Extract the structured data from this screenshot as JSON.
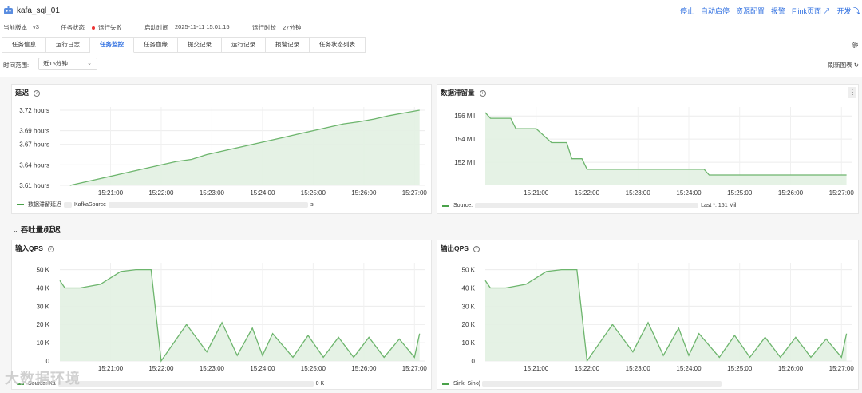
{
  "header": {
    "job_name": "kafa_sql_01",
    "actions": [
      "停止",
      "自动启停",
      "资源配置",
      "报警",
      "Flink页面 ↗",
      "开发 ⤵"
    ]
  },
  "meta": {
    "version_label": "当前版本",
    "version_value": "v3",
    "status_label": "任务状态",
    "status_value": "运行失败",
    "start_label": "启动时间",
    "start_value": "2025-11-11 15:01:15",
    "duration_label": "运行时长",
    "duration_value": "27分钟"
  },
  "tabs": [
    "任务信息",
    "运行日志",
    "任务监控",
    "任务血缘",
    "提交记录",
    "运行记录",
    "报警记录",
    "任务状态列表"
  ],
  "active_tab": 2,
  "time_range": {
    "label": "时间范围:",
    "value": "近15分钟",
    "refresh_label": "刷新图表 ↻"
  },
  "section": {
    "title": "吞吐量/延迟"
  },
  "watermark": "大数据环境",
  "colors": {
    "series": "#6db56d",
    "fill": "#e2f1e2",
    "accent": "#2f6fe0",
    "status": "#e33333"
  },
  "panels": {
    "latency": {
      "title": "延迟",
      "legend": "数据滞留延迟",
      "legend_rest": "KafkaSource",
      "legend_tail": "s"
    },
    "backlog": {
      "title": "数据滞留量",
      "legend": "Source:",
      "legend_tail": "Last *: 151 Mil"
    },
    "input_qps": {
      "title": "输入QPS",
      "legend": "Source: Ka",
      "legend_tail": "0 K"
    },
    "output_qps": {
      "title": "输出QPS",
      "legend": "Sink: Sink(",
      "legend_tail": ""
    }
  },
  "chart_data": [
    {
      "type": "area",
      "title": "延迟",
      "yunit": "hours",
      "yticks": [
        "3.61 hours",
        "3.64 hours",
        "3.67 hours",
        "3.69 hours",
        "3.72 hours"
      ],
      "ylim": [
        3.61,
        3.72
      ],
      "xticks": [
        "15:21:00",
        "15:22:00",
        "15:23:00",
        "15:24:00",
        "15:25:00",
        "15:26:00",
        "15:27:00"
      ],
      "x": [
        20.2,
        20.5,
        20.8,
        21.1,
        21.4,
        21.7,
        22.0,
        22.3,
        22.6,
        22.9,
        23.2,
        23.5,
        23.8,
        24.1,
        24.4,
        24.7,
        25.0,
        25.3,
        25.6,
        25.9,
        26.2,
        26.5,
        26.8,
        27.1
      ],
      "values": [
        3.61,
        3.615,
        3.62,
        3.625,
        3.63,
        3.635,
        3.64,
        3.645,
        3.648,
        3.655,
        3.66,
        3.665,
        3.67,
        3.675,
        3.68,
        3.685,
        3.69,
        3.695,
        3.7,
        3.703,
        3.707,
        3.712,
        3.716,
        3.72
      ],
      "series": [
        {
          "name": "数据滞留延迟"
        }
      ]
    },
    {
      "type": "area",
      "title": "数据滞留量",
      "yticks": [
        "152 Mil",
        "154 Mil",
        "156 Mil"
      ],
      "ylim": [
        150,
        156.5
      ],
      "xticks": [
        "15:21:00",
        "15:22:00",
        "15:23:00",
        "15:24:00",
        "15:25:00",
        "15:26:00",
        "15:27:00"
      ],
      "x": [
        20.0,
        20.1,
        20.3,
        20.5,
        20.6,
        20.9,
        21.0,
        21.3,
        21.4,
        21.6,
        21.7,
        21.9,
        22.0,
        22.5,
        23.0,
        23.5,
        24.0,
        24.3,
        24.4,
        25.0,
        25.5,
        26.0,
        26.5,
        27.1
      ],
      "values": [
        156.3,
        155.8,
        155.8,
        155.8,
        154.9,
        154.9,
        154.9,
        153.7,
        153.7,
        153.7,
        152.3,
        152.3,
        151.4,
        151.4,
        151.4,
        151.4,
        151.4,
        151.4,
        150.9,
        150.9,
        150.9,
        150.9,
        150.9,
        150.9
      ],
      "series": [
        {
          "name": "Source:"
        }
      ]
    },
    {
      "type": "area",
      "title": "输入QPS",
      "yticks": [
        "0",
        "10 K",
        "20 K",
        "30 K",
        "40 K",
        "50 K"
      ],
      "ylim": [
        0,
        52
      ],
      "xticks": [
        "15:21:00",
        "15:22:00",
        "15:23:00",
        "15:24:00",
        "15:25:00",
        "15:26:00",
        "15:27:00"
      ],
      "x": [
        20.0,
        20.1,
        20.4,
        20.8,
        21.2,
        21.5,
        21.8,
        22.0,
        22.5,
        22.9,
        23.2,
        23.5,
        23.8,
        24.0,
        24.2,
        24.6,
        24.9,
        25.2,
        25.5,
        25.8,
        26.1,
        26.4,
        26.7,
        27.0,
        27.1
      ],
      "values": [
        44,
        40,
        40,
        42,
        49,
        50,
        50,
        0,
        20,
        5,
        21,
        3,
        18,
        3,
        15,
        2,
        14,
        2,
        13,
        2,
        13,
        2,
        12,
        2,
        15
      ],
      "series": [
        {
          "name": "Source: Ka"
        }
      ]
    },
    {
      "type": "area",
      "title": "输出QPS",
      "yticks": [
        "0",
        "10 K",
        "20 K",
        "30 K",
        "40 K",
        "50 K"
      ],
      "ylim": [
        0,
        52
      ],
      "xticks": [
        "15:21:00",
        "15:22:00",
        "15:23:00",
        "15:24:00",
        "15:25:00",
        "15:26:00",
        "15:27:00"
      ],
      "x": [
        20.0,
        20.1,
        20.4,
        20.8,
        21.2,
        21.5,
        21.8,
        22.0,
        22.5,
        22.9,
        23.2,
        23.5,
        23.8,
        24.0,
        24.2,
        24.6,
        24.9,
        25.2,
        25.5,
        25.8,
        26.1,
        26.4,
        26.7,
        27.0,
        27.1
      ],
      "values": [
        44,
        40,
        40,
        42,
        49,
        50,
        50,
        0,
        20,
        5,
        21,
        3,
        18,
        3,
        15,
        2,
        14,
        2,
        13,
        2,
        13,
        2,
        12,
        2,
        15
      ],
      "series": [
        {
          "name": "Sink: Sink("
        }
      ]
    }
  ]
}
